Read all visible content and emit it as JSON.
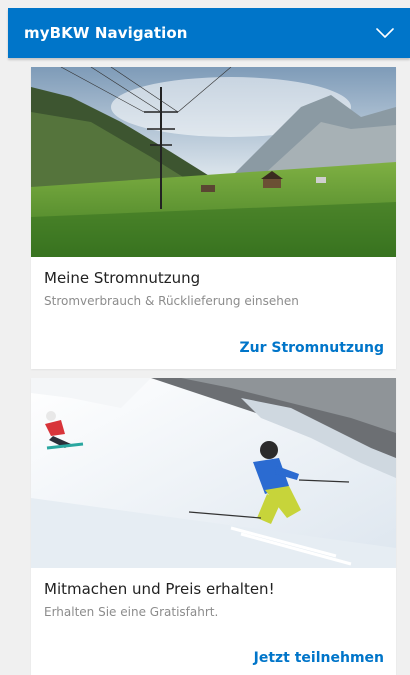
{
  "header": {
    "title": "myBKW Navigation",
    "toggle_icon": "chevron-down-icon"
  },
  "cards": [
    {
      "image": "power-line-landscape",
      "title": "Meine Stromnutzung",
      "subtitle": "Stromverbrauch & Rücklieferung einsehen",
      "link_label": "Zur Stromnutzung"
    },
    {
      "image": "skiers-on-slope",
      "title": "Mitmachen und Preis erhalten!",
      "subtitle": "Erhalten Sie eine Gratisfahrt.",
      "link_label": "Jetzt teilnehmen"
    }
  ],
  "colors": {
    "accent": "#0075c9",
    "background": "#f0f0f0",
    "card": "#ffffff"
  }
}
